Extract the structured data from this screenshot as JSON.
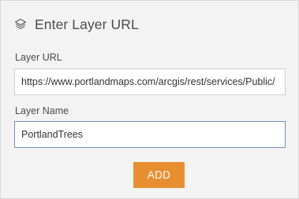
{
  "header": {
    "icon": "layers-icon",
    "title": "Enter Layer URL"
  },
  "form": {
    "url_label": "Layer URL",
    "url_value": "https://www.portlandmaps.com/arcgis/rest/services/Public/",
    "name_label": "Layer Name",
    "name_value": "PortlandTrees"
  },
  "actions": {
    "add_label": "ADD"
  },
  "colors": {
    "panel_background": "#f3f3f3",
    "accent": "#e78e30",
    "focused_border": "#6f8db8"
  }
}
